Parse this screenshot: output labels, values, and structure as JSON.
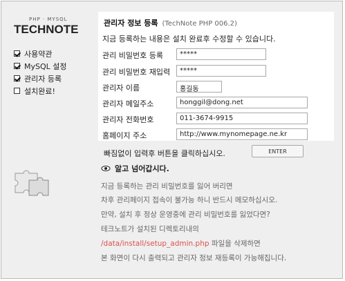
{
  "logo": {
    "small": "PHP · MYSQL",
    "main": "TECHNOTE"
  },
  "steps": [
    {
      "label": "사용약관",
      "checked": true
    },
    {
      "label": "MySQL 설정",
      "checked": true
    },
    {
      "label": "관리자 등록",
      "checked": true
    },
    {
      "label": "설치완료!",
      "checked": false
    }
  ],
  "panel": {
    "title": "관리자 정보 등록",
    "version": "(TechNote PHP 006.2)",
    "notice": "지금 등록하는 내용은 설치 완료후 수정할 수 있습니다.",
    "fields": [
      {
        "label": "관리 비밀번호 등록",
        "value": "*****"
      },
      {
        "label": "관리 비밀번호 재입력",
        "value": "*****"
      },
      {
        "label": "관리자 이름",
        "value": "홍길동"
      },
      {
        "label": "관리자 메일주소",
        "value": "honggil@dong.net"
      },
      {
        "label": "관리자 전화번호",
        "value": "011-3674-9915"
      },
      {
        "label": "홈페이지 주소",
        "value": "http://www.mynomepage.ne.kr"
      }
    ]
  },
  "bottom": {
    "instruction": "빠짐없이 입력후 버튼을 클릭하십시오.",
    "enter_label": "ENTER"
  },
  "note": {
    "heading": "알고 넘어갑시다.",
    "lines": [
      "지금 등록하는 관리 비밀번호를 잃어 버리면",
      "차후 관리페이지 접속이 불가능 하니 반드시 메모하십시오.",
      "만약, 설치 후 정상 운영중에 관리 비밀번호를 잃었다면?",
      "테크노트가 설치된 디렉토리내의",
      "/data/install/setup_admin.php",
      "파일을 삭제하면",
      "본 화면이 다시 출력되고 관리자 정보 재등록이 가능해집니다."
    ]
  },
  "colors": {
    "accent_red": "#d9534f",
    "panel_bg": "#ffffff",
    "frame_bg": "#efefef"
  }
}
